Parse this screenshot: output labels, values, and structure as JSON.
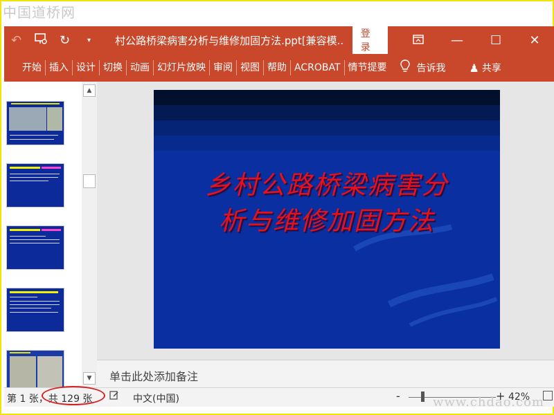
{
  "watermarks": {
    "top": "中国道桥网",
    "bottom": "www.chdao.com"
  },
  "titlebar": {
    "undo_icon": "undo-icon",
    "present_icon": "present-from-start-icon",
    "redo_icon": "redo-icon",
    "customize_icon": "chevron-down-icon",
    "title": "村公路桥梁病害分析与维修加固方法.ppt[兼容模...",
    "login_label": "登录",
    "restore_icon": "ribbon-display-icon",
    "minimize_icon": "minimize-icon",
    "maximize_icon": "maximize-icon",
    "close_icon": "close-icon"
  },
  "ribbon": {
    "tabs": [
      "开始",
      "插入",
      "设计",
      "切换",
      "动画",
      "幻灯片放映",
      "审阅",
      "视图",
      "帮助",
      "ACROBAT",
      "情节提要"
    ],
    "tell_me": "告诉我",
    "share": "共享"
  },
  "slide": {
    "title_line1": "乡村公路桥梁病害分",
    "title_line2": "析与维修加固方法",
    "colors": {
      "background": "#0a2fa0",
      "title": "#e8101a"
    }
  },
  "notes": {
    "placeholder": "单击此处添加备注"
  },
  "statusbar": {
    "slide_info": "第 1 张，共 129 张",
    "language": "中文(中国)",
    "zoom_minus": "-",
    "zoom_plus": "+",
    "zoom": "42%"
  },
  "colors": {
    "accent": "#c9472a",
    "highlight": "#d41f1f",
    "frame": "#f2e600"
  }
}
